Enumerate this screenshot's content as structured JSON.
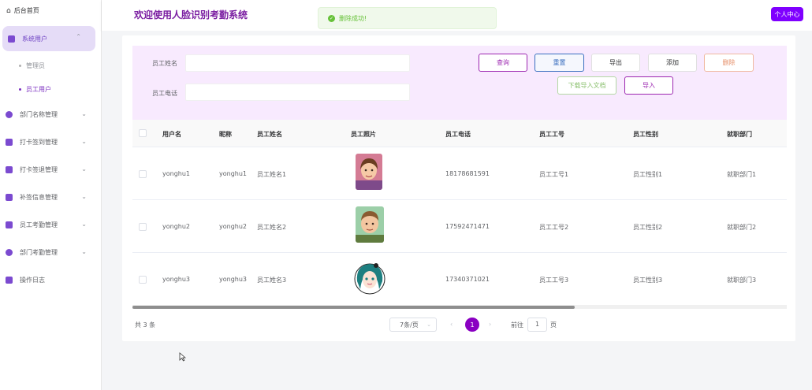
{
  "sidebar": {
    "home": "后台首页",
    "items": [
      {
        "label": "系统用户",
        "icon": "user-group-icon",
        "color": "#7b4ad0",
        "active": true
      },
      {
        "label": "部门名称管理",
        "icon": "department-icon",
        "color": "#7b4ad0"
      },
      {
        "label": "打卡签到管理",
        "icon": "checkin-icon",
        "color": "#7b4ad0"
      },
      {
        "label": "打卡签退管理",
        "icon": "checkout-icon",
        "color": "#7b4ad0"
      },
      {
        "label": "补签信息管理",
        "icon": "resign-icon",
        "color": "#7b4ad0"
      },
      {
        "label": "员工考勤管理",
        "icon": "attendance-icon",
        "color": "#7b4ad0"
      },
      {
        "label": "部门考勤管理",
        "icon": "dept-attendance-icon",
        "color": "#7b4ad0"
      },
      {
        "label": "操作日志",
        "icon": "log-icon",
        "color": "#7b4ad0"
      }
    ],
    "sub_items": [
      {
        "label": "管理员",
        "active": false
      },
      {
        "label": "员工用户",
        "active": true
      }
    ]
  },
  "header": {
    "title": "欢迎使用人脸识别考勤系统",
    "user_center": "个人中心",
    "toast": "删除成功!"
  },
  "search": {
    "name_label": "员工姓名",
    "name_value": "",
    "phone_label": "员工电话",
    "phone_value": ""
  },
  "buttons": {
    "query": "查询",
    "reset": "重置",
    "export": "导出",
    "add": "添加",
    "delete": "删除",
    "download": "下载导入文档",
    "import": "导入"
  },
  "table": {
    "headers": [
      "用户名",
      "昵称",
      "员工姓名",
      "员工照片",
      "员工电话",
      "员工工号",
      "员工性别",
      "就职部门"
    ],
    "rows": [
      {
        "username": "yonghu1",
        "nickname": "yonghu1",
        "name": "员工姓名1",
        "phone": "18178681591",
        "number": "员工工号1",
        "gender": "员工性别1",
        "dept": "就职部门1",
        "photo": "avatar-woman-icon"
      },
      {
        "username": "yonghu2",
        "nickname": "yonghu2",
        "name": "员工姓名2",
        "phone": "17592471471",
        "number": "员工工号2",
        "gender": "员工性别2",
        "dept": "就职部门2",
        "photo": "avatar-man-icon"
      },
      {
        "username": "yonghu3",
        "nickname": "yonghu3",
        "name": "员工姓名3",
        "phone": "17340371021",
        "number": "员工工号3",
        "gender": "员工性别3",
        "dept": "就职部门3",
        "photo": "avatar-girl-icon"
      }
    ]
  },
  "pagination": {
    "total": "共 3 条",
    "page_size": "7条/页",
    "current": "1",
    "goto_label": "前往",
    "goto_value": "1",
    "goto_suffix": "页"
  },
  "colors": {
    "brand": "#7f00ff",
    "accent": "#9c27b0",
    "success": "#67c23a"
  }
}
